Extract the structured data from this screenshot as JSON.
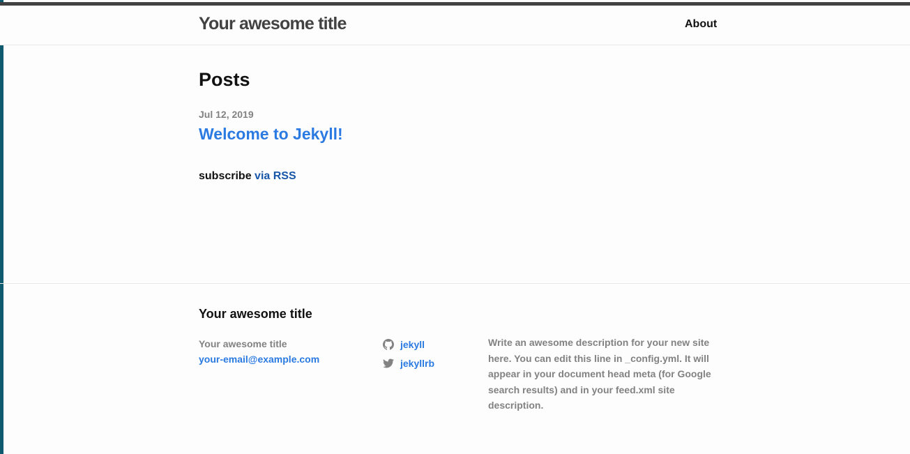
{
  "header": {
    "site_title": "Your awesome title",
    "nav": [
      {
        "label": "About"
      }
    ]
  },
  "main": {
    "heading": "Posts",
    "posts": [
      {
        "date": "Jul 12, 2019",
        "title": "Welcome to Jekyll!"
      }
    ],
    "rss": {
      "prefix": "subscribe",
      "link_label": "via RSS"
    }
  },
  "footer": {
    "heading": "Your awesome title",
    "contact": {
      "name": "Your awesome title",
      "email": "your-email@example.com"
    },
    "social": [
      {
        "icon": "github-icon",
        "label": "jekyll"
      },
      {
        "icon": "twitter-icon",
        "label": "jekyllrb"
      }
    ],
    "description": "Write an awesome description for your new site here. You can edit this line in _config.yml. It will appear in your document head meta (for Google search results) and in your feed.xml site description."
  },
  "colors": {
    "link": "#2a7ae2",
    "rss_link": "#1756a9",
    "muted": "#828282",
    "header_text": "#424242",
    "header_border": "#424242"
  }
}
